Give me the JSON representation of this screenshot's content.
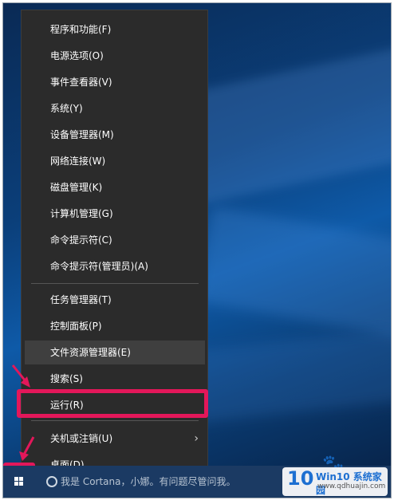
{
  "menu": {
    "items": [
      {
        "label": "程序和功能(F)"
      },
      {
        "label": "电源选项(O)"
      },
      {
        "label": "事件查看器(V)"
      },
      {
        "label": "系统(Y)"
      },
      {
        "label": "设备管理器(M)"
      },
      {
        "label": "网络连接(W)"
      },
      {
        "label": "磁盘管理(K)"
      },
      {
        "label": "计算机管理(G)"
      },
      {
        "label": "命令提示符(C)"
      },
      {
        "label": "命令提示符(管理员)(A)"
      },
      {
        "label": "任务管理器(T)"
      },
      {
        "label": "控制面板(P)"
      },
      {
        "label": "文件资源管理器(E)"
      },
      {
        "label": "搜索(S)"
      },
      {
        "label": "运行(R)"
      },
      {
        "label": "关机或注销(U)"
      },
      {
        "label": "桌面(D)"
      }
    ],
    "submenu_chevron": "›"
  },
  "taskbar": {
    "search_text": "我是 Cortana，小娜。有问题尽管问我。",
    "start_icon": "windows-logo-icon"
  },
  "watermark": {
    "brand_big": "10",
    "brand_title": "Win10 系统家园",
    "brand_url": "www.qdhuajin.com",
    "icon": "paw-icon"
  },
  "colors": {
    "menu_bg": "#2b2b2b",
    "highlight": "#3f3f3f",
    "annotation_red": "#e3175a"
  }
}
